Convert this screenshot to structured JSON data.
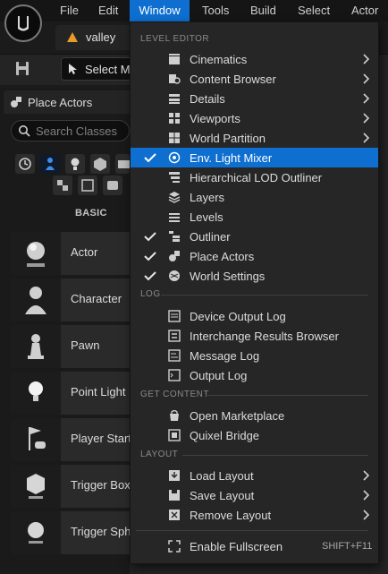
{
  "menubar": {
    "items": [
      "File",
      "Edit",
      "Window",
      "Tools",
      "Build",
      "Select",
      "Actor"
    ],
    "active": "Window"
  },
  "level_tab": {
    "title": "valley"
  },
  "toolbar": {
    "select_mode_label": "Select M"
  },
  "place_actors": {
    "title": "Place Actors",
    "search_placeholder": "Search Classes",
    "category_label": "BASIC",
    "actors": [
      "Actor",
      "Character",
      "Pawn",
      "Point Light",
      "Player Start",
      "Trigger Box",
      "Trigger Sph"
    ]
  },
  "window_menu": {
    "sections": {
      "level_editor": "LEVEL EDITOR",
      "log": "LOG",
      "get_content": "GET CONTENT",
      "layout": "LAYOUT"
    },
    "items": [
      {
        "label": "Cinematics",
        "submenu": true,
        "checked": false,
        "icon": "cinematics-icon"
      },
      {
        "label": "Content Browser",
        "submenu": true,
        "checked": false,
        "icon": "content-browser-icon"
      },
      {
        "label": "Details",
        "submenu": true,
        "checked": false,
        "icon": "details-icon"
      },
      {
        "label": "Viewports",
        "submenu": true,
        "checked": false,
        "icon": "viewports-icon"
      },
      {
        "label": "World Partition",
        "submenu": true,
        "checked": false,
        "icon": "world-partition-icon"
      },
      {
        "label": "Env. Light Mixer",
        "submenu": false,
        "checked": true,
        "highlighted": true,
        "icon": "light-mixer-icon"
      },
      {
        "label": "Hierarchical LOD Outliner",
        "submenu": false,
        "checked": false,
        "icon": "hlod-icon"
      },
      {
        "label": "Layers",
        "submenu": false,
        "checked": false,
        "icon": "layers-icon"
      },
      {
        "label": "Levels",
        "submenu": false,
        "checked": false,
        "icon": "levels-icon"
      },
      {
        "label": "Outliner",
        "submenu": false,
        "checked": true,
        "icon": "outliner-icon"
      },
      {
        "label": "Place Actors",
        "submenu": false,
        "checked": true,
        "icon": "place-actors-icon"
      },
      {
        "label": "World Settings",
        "submenu": false,
        "checked": true,
        "icon": "world-settings-icon"
      },
      {
        "label": "Device Output Log",
        "submenu": false,
        "checked": false,
        "icon": "device-log-icon"
      },
      {
        "label": "Interchange Results Browser",
        "submenu": false,
        "checked": false,
        "icon": "interchange-icon"
      },
      {
        "label": "Message Log",
        "submenu": false,
        "checked": false,
        "icon": "message-log-icon"
      },
      {
        "label": "Output Log",
        "submenu": false,
        "checked": false,
        "icon": "output-log-icon"
      },
      {
        "label": "Open Marketplace",
        "submenu": false,
        "checked": false,
        "icon": "marketplace-icon"
      },
      {
        "label": "Quixel Bridge",
        "submenu": false,
        "checked": false,
        "icon": "quixel-icon"
      },
      {
        "label": "Load Layout",
        "submenu": true,
        "checked": false,
        "icon": "load-layout-icon"
      },
      {
        "label": "Save Layout",
        "submenu": true,
        "checked": false,
        "icon": "save-layout-icon"
      },
      {
        "label": "Remove Layout",
        "submenu": true,
        "checked": false,
        "icon": "remove-layout-icon"
      },
      {
        "label": "Enable Fullscreen",
        "submenu": false,
        "checked": false,
        "icon": "fullscreen-icon",
        "shortcut": "SHIFT+F11"
      }
    ]
  },
  "colors": {
    "accent": "#0e6fd1",
    "menu_bg": "#262626",
    "panel_bg": "#1a1a1a"
  }
}
